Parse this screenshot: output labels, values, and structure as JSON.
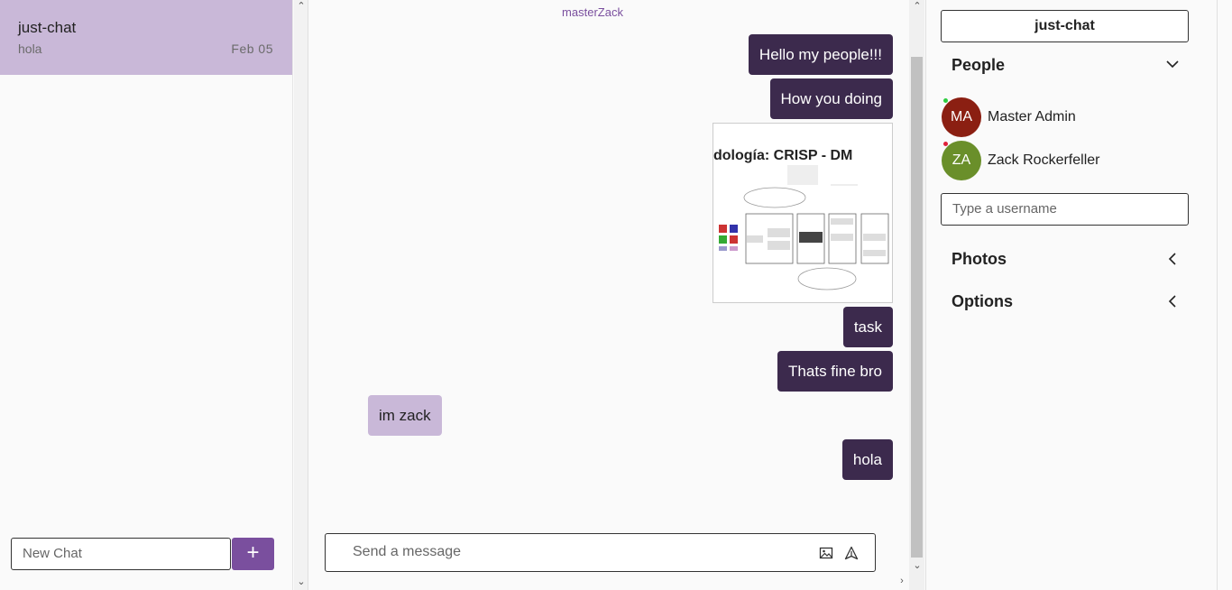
{
  "sidebar": {
    "chats": [
      {
        "name": "just-chat",
        "last_message": "hola",
        "date": "Feb 05"
      }
    ],
    "new_chat_placeholder": "New Chat",
    "add_label": "+"
  },
  "conversation": {
    "title": "masterZack",
    "messages": [
      {
        "text": "Hello my people!!!",
        "direction": "out"
      },
      {
        "text": "How you doing",
        "direction": "out"
      },
      {
        "type": "image",
        "image_title": "dología: CRISP - DM",
        "direction": "out"
      },
      {
        "text": "task",
        "direction": "out"
      },
      {
        "text": "Thats fine bro",
        "direction": "out"
      },
      {
        "text": "im zack",
        "direction": "in"
      },
      {
        "text": "hola",
        "direction": "out"
      }
    ],
    "send_placeholder": "Send a message"
  },
  "details": {
    "chat_title": "just-chat",
    "people_label": "People",
    "people": [
      {
        "initials": "MA",
        "name": "Master Admin",
        "color": "#8b1f12",
        "status_color": "#2ecc40"
      },
      {
        "initials": "ZA",
        "name": "Zack Rockerfeller",
        "color": "#6a8f2a",
        "status_color": "#e0203a"
      }
    ],
    "username_placeholder": "Type a username",
    "photos_label": "Photos",
    "options_label": "Options"
  },
  "colors": {
    "accent": "#7a4f9e",
    "outgoing_bubble": "#3c2a4d",
    "incoming_bubble": "#c9b8d8",
    "selected_chat": "#c9b8d8"
  }
}
